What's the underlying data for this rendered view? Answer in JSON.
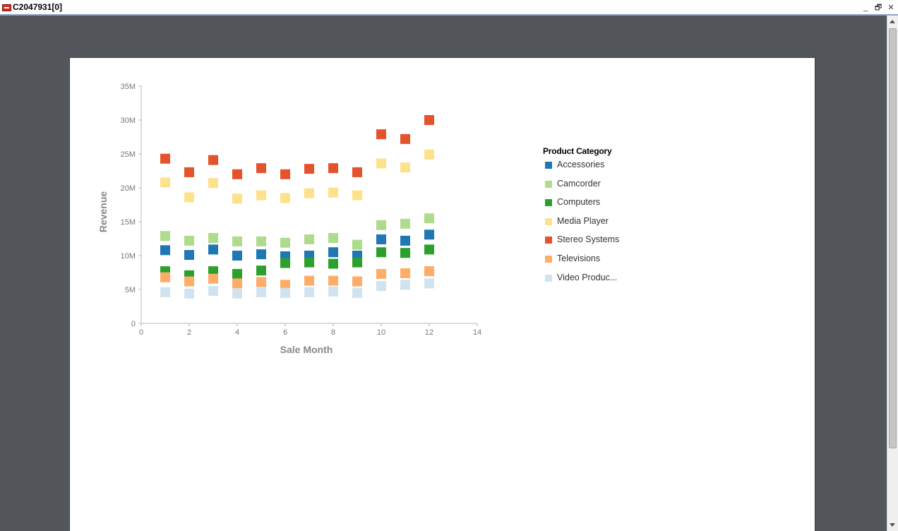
{
  "window": {
    "title": "C2047931[0]",
    "icon": "report-icon",
    "controls": [
      "minimize-icon",
      "restore-icon",
      "close-icon"
    ]
  },
  "chart_data": {
    "type": "scatter",
    "xlabel": "Sale Month",
    "ylabel": "Revenue",
    "xlim": [
      0,
      14
    ],
    "ylim": [
      0,
      35000000
    ],
    "x_ticks": [
      "0",
      "2",
      "4",
      "6",
      "8",
      "10",
      "12",
      "14"
    ],
    "y_ticks": [
      "0",
      "5M",
      "10M",
      "15M",
      "20M",
      "25M",
      "30M",
      "35M"
    ],
    "grid": false,
    "legend_title": "Product Category",
    "legend_position": "right",
    "series": [
      {
        "name": "Accessories",
        "color": "#1f77b4",
        "x": [
          1,
          2,
          3,
          4,
          5,
          6,
          7,
          8,
          9,
          10,
          11,
          12
        ],
        "y": [
          10800000,
          10100000,
          10900000,
          10000000,
          10200000,
          9900000,
          10000000,
          10500000,
          10000000,
          12400000,
          12200000,
          13100000
        ]
      },
      {
        "name": "Camcorder",
        "color": "#aedc8c",
        "x": [
          1,
          2,
          3,
          4,
          5,
          6,
          7,
          8,
          9,
          10,
          11,
          12
        ],
        "y": [
          12900000,
          12200000,
          12600000,
          12100000,
          12100000,
          11900000,
          12400000,
          12600000,
          11600000,
          14500000,
          14700000,
          15500000
        ]
      },
      {
        "name": "Computers",
        "color": "#2ca02c",
        "x": [
          1,
          2,
          3,
          4,
          5,
          6,
          7,
          8,
          9,
          10,
          11,
          12
        ],
        "y": [
          7700000,
          7100000,
          7700000,
          7300000,
          7800000,
          8900000,
          9000000,
          8800000,
          9000000,
          10500000,
          10400000,
          10900000
        ]
      },
      {
        "name": "Media Player",
        "color": "#fde28c",
        "x": [
          1,
          2,
          3,
          4,
          5,
          6,
          7,
          8,
          9,
          10,
          11,
          12
        ],
        "y": [
          20800000,
          18600000,
          20700000,
          18400000,
          18900000,
          18500000,
          19200000,
          19300000,
          18900000,
          23600000,
          23000000,
          24900000
        ]
      },
      {
        "name": "Stereo Systems",
        "color": "#e5532c",
        "x": [
          1,
          2,
          3,
          4,
          5,
          6,
          7,
          8,
          9,
          10,
          11,
          12
        ],
        "y": [
          24300000,
          22300000,
          24100000,
          22000000,
          22900000,
          22000000,
          22800000,
          22900000,
          22300000,
          27900000,
          27200000,
          30000000
        ]
      },
      {
        "name": "Televisions",
        "color": "#fdad68",
        "x": [
          1,
          2,
          3,
          4,
          5,
          6,
          7,
          8,
          9,
          10,
          11,
          12
        ],
        "y": [
          6800000,
          6200000,
          6600000,
          5900000,
          6100000,
          5700000,
          6300000,
          6300000,
          6200000,
          7300000,
          7400000,
          7700000
        ]
      },
      {
        "name": "Video Produc...",
        "color": "#d1e3ef",
        "x": [
          1,
          2,
          3,
          4,
          5,
          6,
          7,
          8,
          9,
          10,
          11,
          12
        ],
        "y": [
          4600000,
          4400000,
          4800000,
          4400000,
          4600000,
          4500000,
          4600000,
          4700000,
          4500000,
          5500000,
          5700000,
          5900000
        ]
      }
    ]
  }
}
